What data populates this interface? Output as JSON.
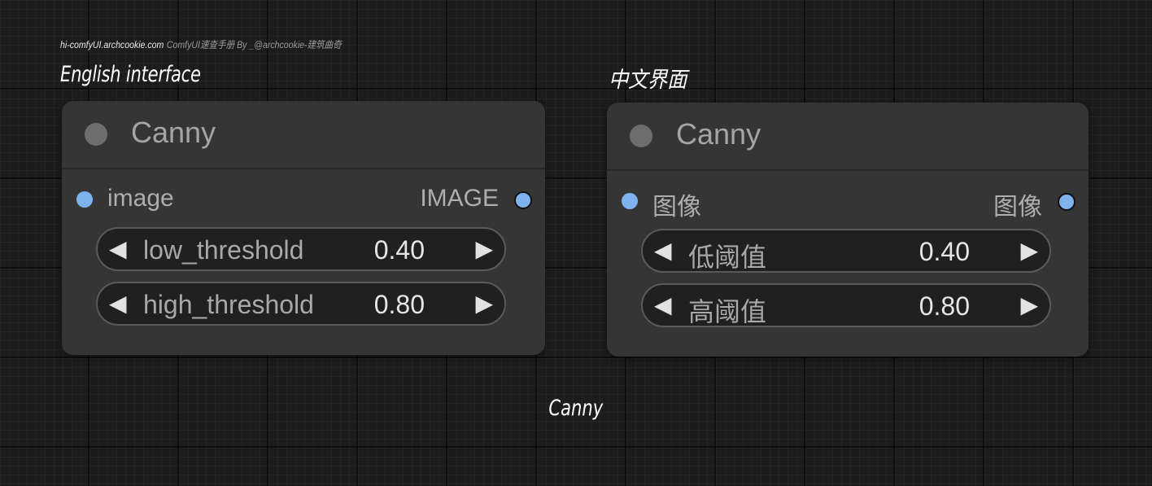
{
  "watermark": {
    "site": "hi-comfyUI.archcookie.com",
    "credit": "ComfyUI速查手册  By _@archcookie-建筑曲奇"
  },
  "sections": {
    "english_title": "English interface",
    "chinese_title": "中文界面"
  },
  "caption": "Canny",
  "node_en": {
    "title": "Canny",
    "input_label": "image",
    "output_label": "IMAGE",
    "widgets": [
      {
        "label": "low_threshold",
        "value": "0.40"
      },
      {
        "label": "high_threshold",
        "value": "0.80"
      }
    ]
  },
  "node_zh": {
    "title": "Canny",
    "input_label": "图像",
    "output_label": "图像",
    "widgets": [
      {
        "label": "低阈值",
        "value": "0.40"
      },
      {
        "label": "高阈值",
        "value": "0.80"
      }
    ]
  },
  "icons": {
    "decrement": "◀",
    "increment": "▶"
  },
  "colors": {
    "canvas": "#1c1c1c",
    "node_bg": "#353535",
    "slot_blue": "#7db3ee",
    "status_dot": "#6e6e6e"
  }
}
